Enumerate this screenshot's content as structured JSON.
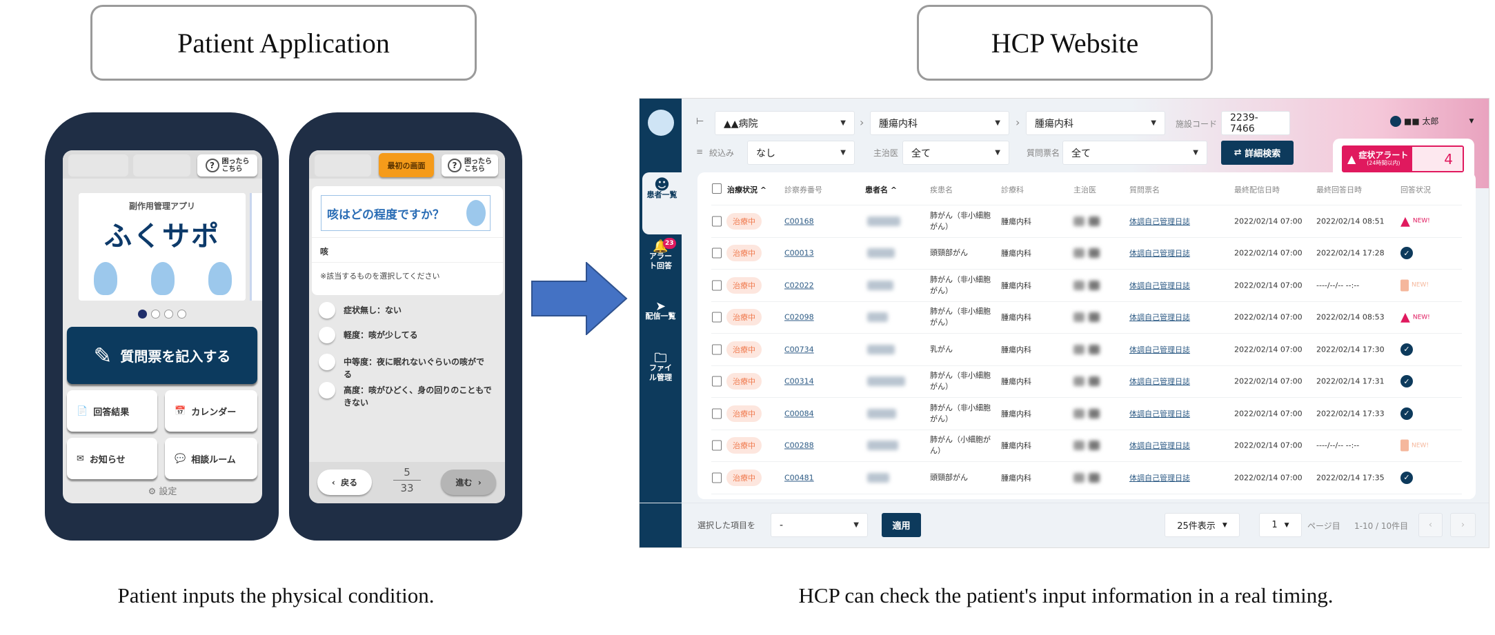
{
  "titles": {
    "left": "Patient Application",
    "right": "HCP Website"
  },
  "captions": {
    "left": "Patient inputs the physical condition.",
    "right": "HCP can check the patient's input information in a real timing."
  },
  "phone1": {
    "help_label": "困ったら\nこちら",
    "app_subtitle": "副作用管理アプリ",
    "app_name": "ふくサポ",
    "carousel_pages": 4,
    "carousel_active": 1,
    "main_button": "質問票を記入する",
    "tiles": [
      {
        "label": "回答結果",
        "icon": "document-icon"
      },
      {
        "label": "カレンダー",
        "icon": "calendar-icon"
      },
      {
        "label": "お知らせ",
        "icon": "mail-icon"
      },
      {
        "label": "相談ルーム",
        "icon": "chat-icon"
      }
    ],
    "settings_label": "設定"
  },
  "phone2": {
    "home_button": "最初の画面",
    "help_label": "困ったら\nこちら",
    "question": "咳はどの程度ですか？",
    "symptom": "咳",
    "instruction": "※該当するものを選択してください",
    "options": [
      "症状無し：ない",
      "軽度：咳が少してる",
      "中等度：夜に眠れないぐらいの咳がでる",
      "高度：咳がひどく、身の回りのこともできない"
    ],
    "back_label": "戻る",
    "page_current": "5",
    "page_total": "33",
    "next_label": "進む"
  },
  "arrow_color": "#4472c4",
  "hcp": {
    "sidebar": [
      {
        "label": "患者一覧",
        "icon": "person-icon",
        "active": true
      },
      {
        "label": "アラート回答",
        "icon": "bell-icon",
        "badge": "23"
      },
      {
        "label": "配信一覧",
        "icon": "paper-plane-icon"
      },
      {
        "label": "ファイル管理",
        "icon": "folder-icon"
      }
    ],
    "hospital": "▲▲病院",
    "dept1": "腫瘍内科",
    "dept2": "腫瘍内科",
    "facility_code_label": "施設コード",
    "facility_code": "2239-7466",
    "user_name": "■■ 太郎",
    "filter_label": "絞込み",
    "filter_value": "なし",
    "doctor_label": "主治医",
    "doctor_value": "全て",
    "questionnaire_label": "質問票名",
    "questionnaire_value": "全て",
    "detail_search": "詳細検索",
    "alert_label": "症状アラート",
    "alert_sub": "(24時間以内)",
    "alert_count": "4",
    "columns": [
      "治療状況 ^",
      "診察券番号",
      "患者名 ^",
      "疾患名",
      "診療科",
      "主治医",
      "質問票名",
      "最終配信日時",
      "最終回答日時",
      "回答状況"
    ],
    "rows": [
      {
        "status": "治療中",
        "id": "C00168",
        "disease": "肺がん（非小細胞がん）",
        "dept": "腫瘍内科",
        "q": "体調自己管理日誌",
        "sent": "2022/02/14 07:00",
        "answered": "2022/02/14 08:51",
        "answer": "alert"
      },
      {
        "status": "治療中",
        "id": "C00013",
        "disease": "頭頸部がん",
        "dept": "腫瘍内科",
        "q": "体調自己管理日誌",
        "sent": "2022/02/14 07:00",
        "answered": "2022/02/14 17:28",
        "answer": "done"
      },
      {
        "status": "治療中",
        "id": "C02022",
        "disease": "肺がん（非小細胞がん）",
        "dept": "腫瘍内科",
        "q": "体調自己管理日誌",
        "sent": "2022/02/14 07:00",
        "answered": "----/--/-- --:--",
        "answer": "pending"
      },
      {
        "status": "治療中",
        "id": "C02098",
        "disease": "肺がん（非小細胞がん）",
        "dept": "腫瘍内科",
        "q": "体調自己管理日誌",
        "sent": "2022/02/14 07:00",
        "answered": "2022/02/14 08:53",
        "answer": "alert"
      },
      {
        "status": "治療中",
        "id": "C00734",
        "disease": "乳がん",
        "dept": "腫瘍内科",
        "q": "体調自己管理日誌",
        "sent": "2022/02/14 07:00",
        "answered": "2022/02/14 17:30",
        "answer": "done"
      },
      {
        "status": "治療中",
        "id": "C00314",
        "disease": "肺がん（非小細胞がん）",
        "dept": "腫瘍内科",
        "q": "体調自己管理日誌",
        "sent": "2022/02/14 07:00",
        "answered": "2022/02/14 17:31",
        "answer": "done"
      },
      {
        "status": "治療中",
        "id": "C00084",
        "disease": "肺がん（非小細胞がん）",
        "dept": "腫瘍内科",
        "q": "体調自己管理日誌",
        "sent": "2022/02/14 07:00",
        "answered": "2022/02/14 17:33",
        "answer": "done"
      },
      {
        "status": "治療中",
        "id": "C00288",
        "disease": "肺がん（小細胞がん）",
        "dept": "腫瘍内科",
        "q": "体調自己管理日誌",
        "sent": "2022/02/14 07:00",
        "answered": "----/--/-- --:--",
        "answer": "pending"
      },
      {
        "status": "治療中",
        "id": "C00481",
        "disease": "頭頸部がん",
        "dept": "腫瘍内科",
        "q": "体調自己管理日誌",
        "sent": "2022/02/14 07:00",
        "answered": "2022/02/14 17:35",
        "answer": "done"
      }
    ],
    "new_label": "NEW!",
    "bulk_label": "選択した項目を",
    "bulk_value": "-",
    "apply_label": "適用",
    "per_page": "25件表示",
    "page": "1",
    "page_suffix": "ページ目",
    "range": "1-10 / 10件目",
    "colors": {
      "navy": "#0d3a5c",
      "alert": "#e0195e",
      "status_bg": "#fde6de",
      "status_text": "#f07a4e"
    }
  }
}
